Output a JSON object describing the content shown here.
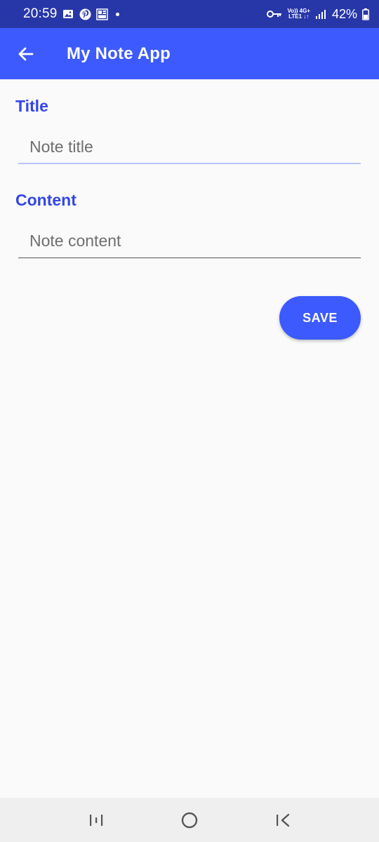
{
  "status_bar": {
    "time": "20:59",
    "net_top": "Vo)) 4G+",
    "net_bottom": "LTE1 ↓↑",
    "battery": "42%",
    "icons": [
      "image-icon",
      "pinterest-icon",
      "widget-icon",
      "dot-icon",
      "key-icon",
      "signal-icon",
      "battery-icon"
    ]
  },
  "app_bar": {
    "title": "My Note App",
    "back_icon": "arrow-left-icon"
  },
  "form": {
    "title_label": "Title",
    "title_placeholder": "Note title",
    "title_value": "",
    "content_label": "Content",
    "content_placeholder": "Note content",
    "content_value": "",
    "save_label": "SAVE"
  },
  "nav_bar": {
    "icons": [
      "recents-icon",
      "home-icon",
      "back-icon"
    ]
  },
  "colors": {
    "status_bar": "#2837a8",
    "app_bar": "#3c5afe",
    "label": "#3346e6",
    "background": "#fafafa"
  }
}
